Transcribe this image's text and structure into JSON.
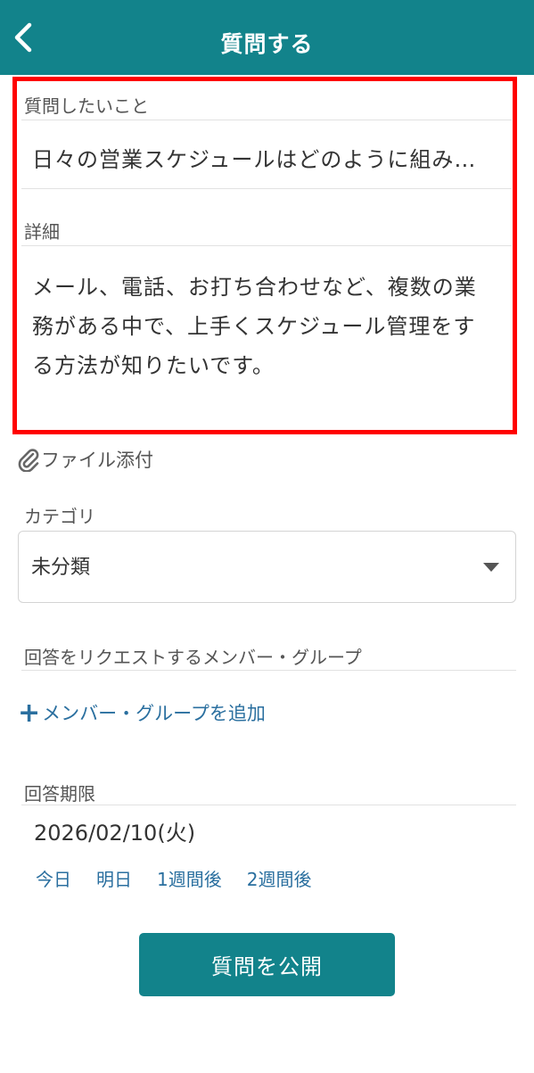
{
  "header": {
    "title": "質問する",
    "back_icon": "chevron-left-icon",
    "background": "#12838b"
  },
  "question": {
    "label": "質問したいこと",
    "value": "日々の営業スケジュールはどのように組み…"
  },
  "detail": {
    "label": "詳細",
    "value": "メール、電話、お打ち合わせなど、複数の業務がある中で、上手くスケジュール管理をする方法が知りたいです。"
  },
  "attachment": {
    "icon": "paperclip-icon",
    "label": "ファイル添付"
  },
  "category": {
    "label": "カテゴリ",
    "selected": "未分類"
  },
  "request": {
    "label": "回答をリクエストするメンバー・グループ",
    "add_label": "メンバー・グループを追加"
  },
  "deadline": {
    "label": "回答期限",
    "value": "2026/02/10(火)",
    "quick": [
      "今日",
      "明日",
      "1週間後",
      "2週間後"
    ]
  },
  "submit": {
    "label": "質問を公開"
  },
  "colors": {
    "accent": "#12838b",
    "link": "#2a6f9f",
    "highlight": "#ff0000"
  }
}
